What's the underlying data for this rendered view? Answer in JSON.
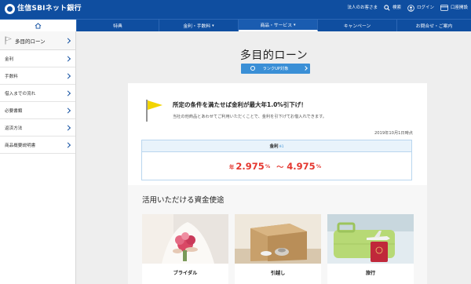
{
  "header": {
    "logo_text": "住信SBIネット銀行",
    "links": [
      {
        "label": "法人のお客さま",
        "icon": "none"
      },
      {
        "label": "検索",
        "icon": "search-icon"
      },
      {
        "label": "ログイン",
        "icon": "user-icon"
      },
      {
        "label": "口座開設",
        "icon": "card-icon"
      }
    ]
  },
  "nav": {
    "items": [
      {
        "label": "",
        "icon": "home-icon"
      },
      {
        "label": "特典"
      },
      {
        "label": "金利・手数料",
        "caret": "▾"
      },
      {
        "label": "商品・サービス",
        "caret": "▾"
      },
      {
        "label": "キャンペーン"
      },
      {
        "label": "お問合せ・ご案内"
      }
    ]
  },
  "sidebar": {
    "title": "多目的ローン",
    "items": [
      {
        "label": "金利"
      },
      {
        "label": "手数料"
      },
      {
        "label": "借入までの流れ"
      },
      {
        "label": "必要書類"
      },
      {
        "label": "返済方法"
      },
      {
        "label": "商品概要説明書"
      }
    ]
  },
  "main": {
    "title": "多目的ローン",
    "rankup_button": "ランクUP対象",
    "promo_heading": "所定の条件を満たせば金利が最大年1.0%引下げ！",
    "promo_text": "当社の他商品とあわせてご利用いただくことで、金利を引下げてお借入れできます。",
    "as_of": "2019年10月1日時点",
    "rate": {
      "label": "金利",
      "note_mark": "※1",
      "prefix": "年",
      "low": "2.975",
      "high": "4.975",
      "unit": "%",
      "separator": "～"
    },
    "usage": {
      "title": "活用いただける資金使途",
      "cards": [
        {
          "label": "ブライダル"
        },
        {
          "label": "引越し"
        },
        {
          "label": "旅行"
        }
      ]
    }
  },
  "colors": {
    "brand_blue": "#0f4ea0",
    "button_blue": "#3a8fd6",
    "rate_red": "#e4372f",
    "flag_yellow": "#f2d400"
  }
}
